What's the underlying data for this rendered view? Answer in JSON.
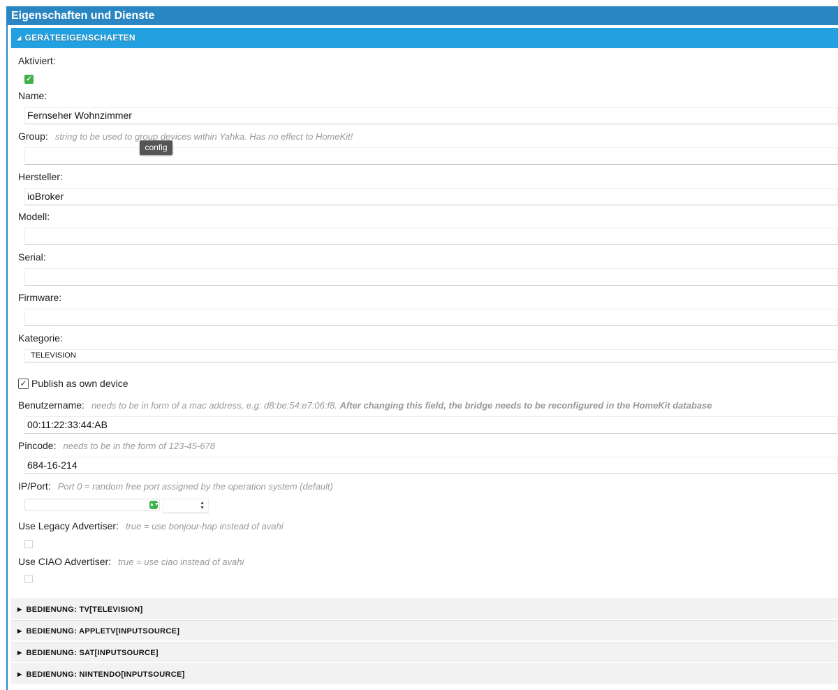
{
  "window": {
    "title": "Eigenschaften und Dienste"
  },
  "section": {
    "title": "GERÄTEEIGENSCHAFTEN",
    "icon": "triangle-down-icon"
  },
  "fields": {
    "activated": {
      "label": "Aktiviert:",
      "checked": true
    },
    "name": {
      "label": "Name:",
      "value": "Fernseher Wohnzimmer"
    },
    "group": {
      "label": "Group:",
      "hint": "string to be used to group devices within Yahka. Has no effect to HomeKit!",
      "value": "",
      "tooltip": "config"
    },
    "manufacturer": {
      "label": "Hersteller:",
      "value": "ioBroker"
    },
    "model": {
      "label": "Modell:",
      "value": ""
    },
    "serial": {
      "label": "Serial:",
      "value": ""
    },
    "firmware": {
      "label": "Firmware:",
      "value": ""
    },
    "category": {
      "label": "Kategorie:",
      "value": "TELEVISION"
    },
    "publish": {
      "label": "Publish as own device",
      "checked": true
    },
    "username": {
      "label": "Benutzername:",
      "hint": "needs to be in form of a mac address, e.g: d8:be:54:e7:06:f8.",
      "hint_bold": "After changing this field, the bridge needs to be reconfigured in the HomeKit database",
      "value": "00:11:22:33:44:AB"
    },
    "pincode": {
      "label": "Pincode:",
      "hint": "needs to be in the form of 123-45-678",
      "value": "684-16-214"
    },
    "ipport": {
      "label": "IP/Port:",
      "hint": "Port 0 = random free port assigned by the operation system (default)",
      "ip_value": "",
      "port_value": ""
    },
    "legacy": {
      "label": "Use Legacy Advertiser:",
      "hint": "true = use bonjour-hap instead of avahi",
      "checked": false
    },
    "ciao": {
      "label": "Use CIAO Advertiser:",
      "hint": "true = use ciao instead of avahi",
      "checked": false
    }
  },
  "services": [
    {
      "label": "BEDIENUNG: TV[TELEVISION]"
    },
    {
      "label": "BEDIENUNG: APPLETV[INPUTSOURCE]"
    },
    {
      "label": "BEDIENUNG: SAT[INPUTSOURCE]"
    },
    {
      "label": "BEDIENUNG: NINTENDO[INPUTSOURCE]"
    }
  ],
  "colors": {
    "header": "#2a86c3",
    "section": "#22a0df",
    "accent_green": "#3fb04a"
  }
}
